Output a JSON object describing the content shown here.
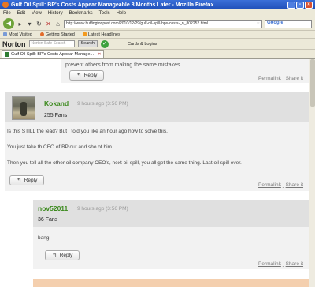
{
  "browser": {
    "window_title": "Gulf Oil Spill: BP's Costs Appear Manageable 8 Months Later - Mozilla Firefox",
    "menu": [
      "File",
      "Edit",
      "View",
      "History",
      "Bookmarks",
      "Tools",
      "Help"
    ],
    "url": "http://www.huffingtonpost.com/2010/12/29/gulf-oil-spill-bps-costs-_n_802252.html",
    "search_engine": "Google",
    "bookmarks": [
      "Most Visited",
      "Getting Started",
      "Latest Headlines"
    ],
    "norton": {
      "logo": "Norton",
      "search_placeholder": "Norton Safe Search",
      "search_button": "Search",
      "cards_label": "Cards & Logins"
    },
    "tab_title": "Gulf Oil Spill: BP's Costs Appear Manage..."
  },
  "comments": {
    "previous": {
      "text_tail": "prevent others from making the same mistakes.",
      "reply_label": "Reply",
      "permalink": "Permalink",
      "share": "Share it"
    },
    "kokand": {
      "username": "Kokand",
      "time": "9 hours ago (3:56 PM)",
      "fans": "255 Fans",
      "paragraphs": [
        "Is this STILL the lead? But I told you like an hour ago how to solve this.",
        "You just take th CEO of BP out and sho.ot him.",
        "Then you tell all the other oil company CEO's, next oil spill, you all get the same thing. Last oil spill ever."
      ],
      "reply_label": "Reply",
      "permalink": "Permalink",
      "share": "Share it"
    },
    "nov52011": {
      "username": "nov52011",
      "time": "9 hours ago (3:56 PM)",
      "fans": "36 Fans",
      "text": "bang",
      "reply_label": "Reply",
      "permalink": "Permalink",
      "share": "Share it"
    }
  }
}
